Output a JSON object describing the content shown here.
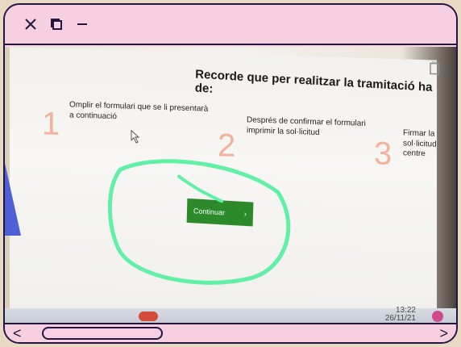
{
  "title_bar": {
    "close_icon": "close-icon",
    "copy_icon": "copy-icon",
    "minimize_icon": "minimize-icon"
  },
  "screen": {
    "heading": "Recorde que per realitzar la tramitació ha de:",
    "steps": [
      {
        "number": "1",
        "text": "Omplir el formulari que se li presentarà a continuació"
      },
      {
        "number": "2",
        "text": "Després de confirmar el formulari imprimir la sol·licitud"
      },
      {
        "number": "3",
        "text": "Firmar la sol·licitud centre"
      }
    ],
    "continue_label": "Continuar",
    "continue_arrow": "›",
    "clock_time": "13:22",
    "clock_date": "26/11/21"
  },
  "bottom_bar": {
    "left_nav": "<",
    "right_nav": ">"
  },
  "colors": {
    "frame": "#24163f",
    "pink": "#f6cfe1",
    "green_button": "#2d8a2a",
    "highlight": "#61f0a6"
  }
}
